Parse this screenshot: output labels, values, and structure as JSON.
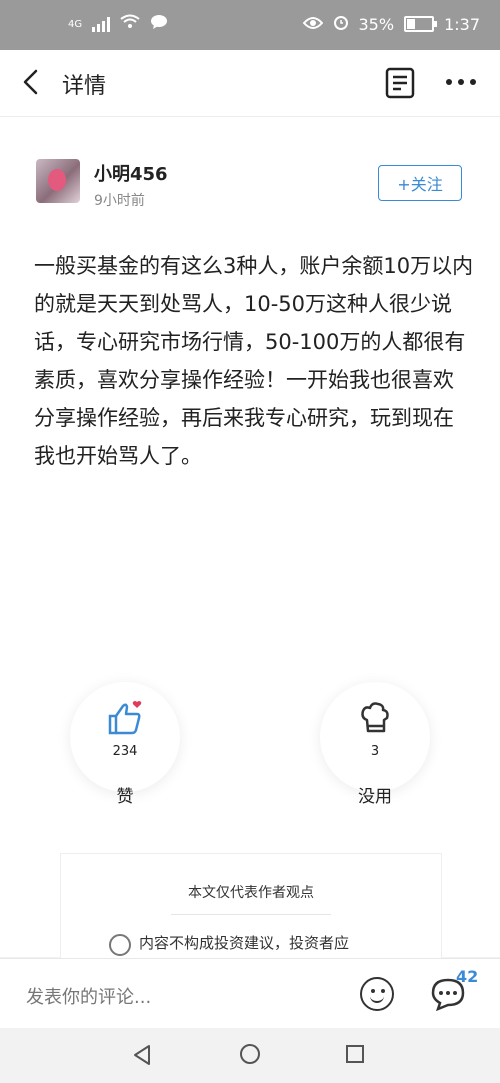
{
  "status_bar": {
    "network": "4G",
    "battery": "35%",
    "time": "1:37"
  },
  "header": {
    "title": "详情"
  },
  "post": {
    "author": "小明456",
    "time": "9小时前",
    "follow_label": "+关注",
    "text": "一般买基金的有这么3种人，账户余额10万以内的就是天天到处骂人，10-50万这种人很少说话，专心研究市场行情，50-100万的人都很有素质，喜欢分享操作经验！一开始我也很喜欢分享操作经验，再后来我专心研究，玩到现在我也开始骂人了。"
  },
  "actions": {
    "like": {
      "count": "234",
      "label": "赞"
    },
    "useless": {
      "count": "3",
      "label": "没用"
    }
  },
  "disclaimer": {
    "title": "本文仅代表作者观点",
    "text": "内容不构成投资建议，投资者应"
  },
  "comment_bar": {
    "placeholder": "发表你的评论...",
    "comment_count": "42"
  },
  "colors": {
    "accent": "#3a8ad6",
    "like_heart": "#e23b5a"
  }
}
